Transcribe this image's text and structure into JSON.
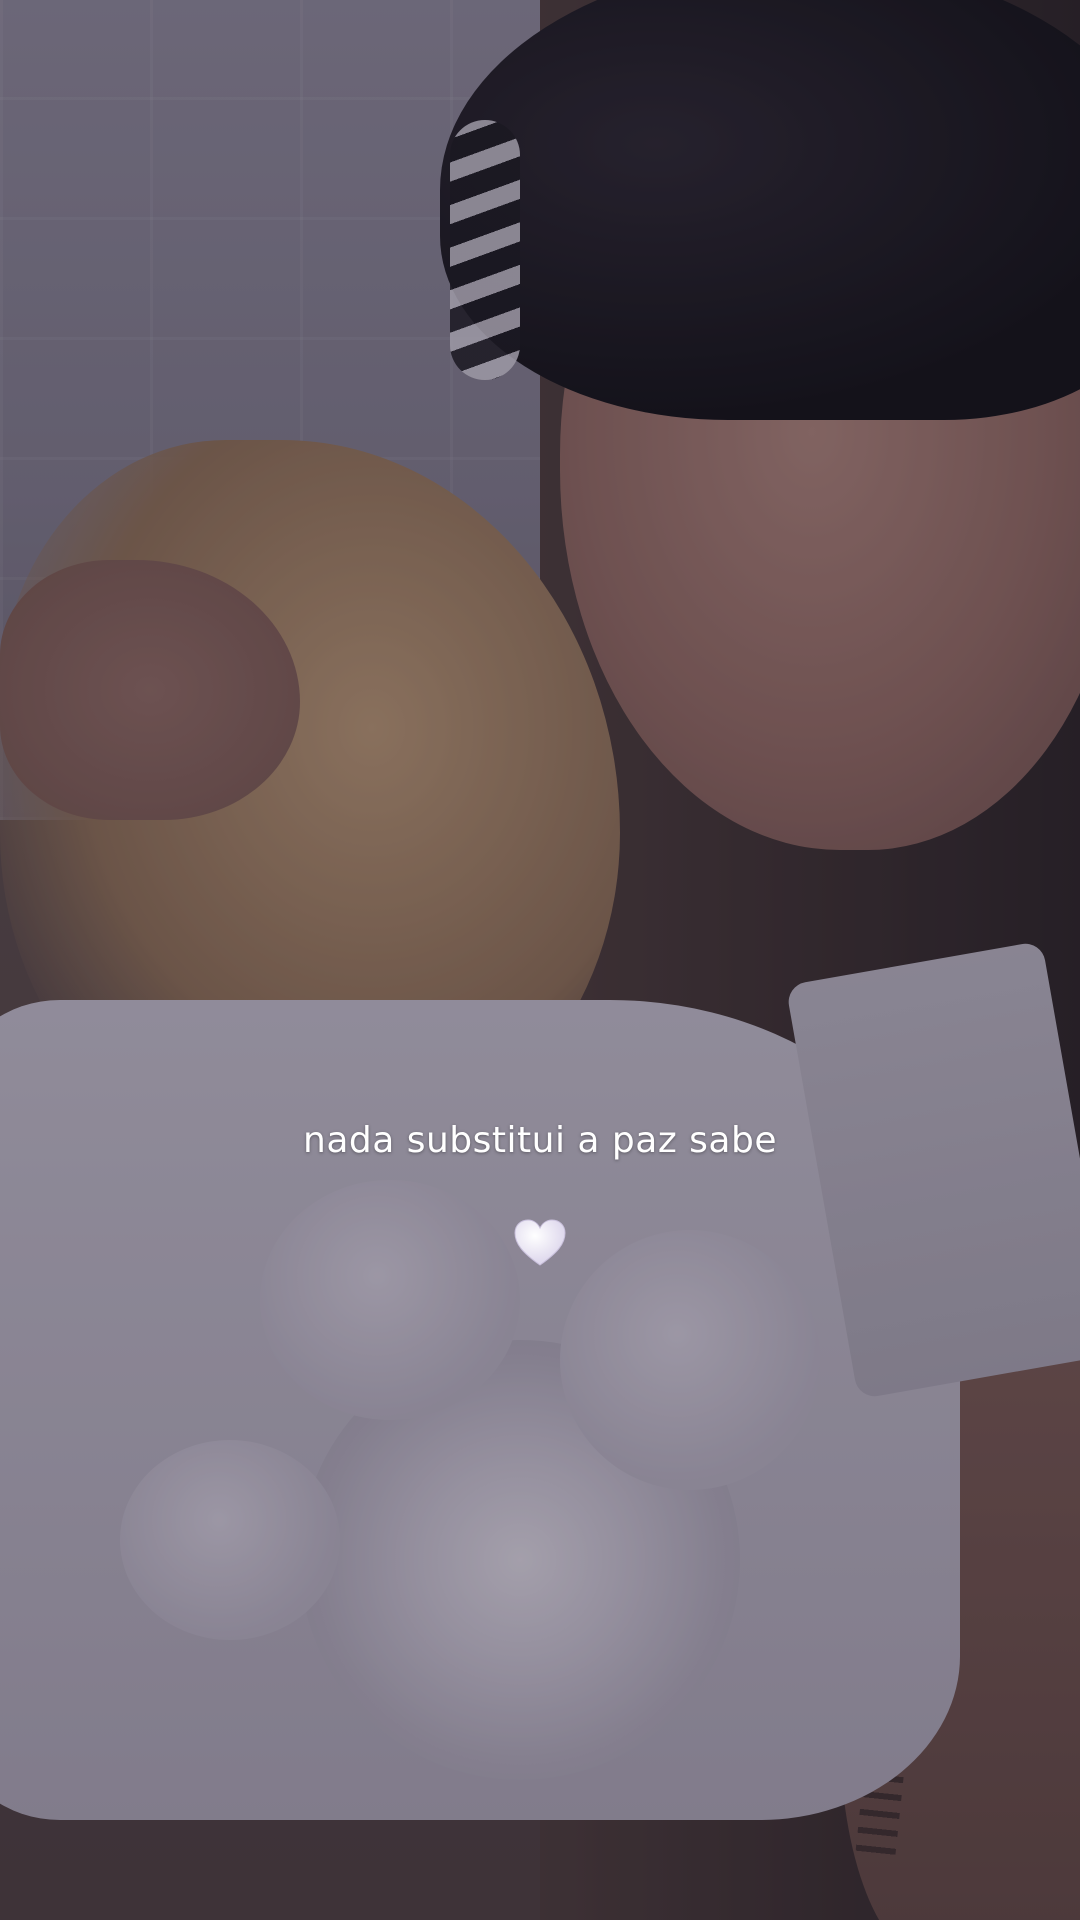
{
  "story": {
    "caption": "nada substitui a paz sabe",
    "sticker": {
      "icon": "white-heart-icon",
      "color": "#f1ecfa"
    }
  }
}
